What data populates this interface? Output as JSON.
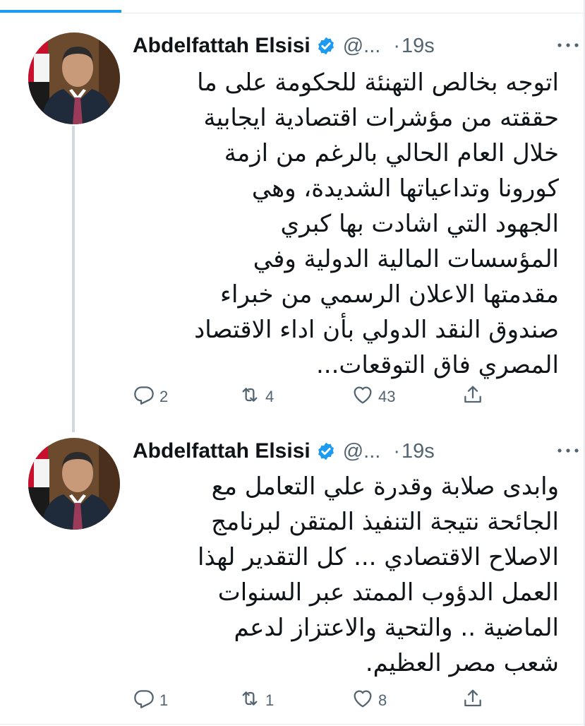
{
  "accent_color": "#1d9bf0",
  "tweets": [
    {
      "author": {
        "name": "Abdelfattah Elsisi",
        "handle": "@...",
        "verified_icon": "verified-badge-icon"
      },
      "separator": "·",
      "time": "19s",
      "text_lines": [
        "اتوجه بخالص التهنئة للحكومة على ما",
        "حققته من مؤشرات اقتصادية ايجابية",
        "خلال العام الحالي بالرغم من ازمة",
        "كورونا وتداعياتها الشديدة، وهي",
        "الجهود التي اشادت بها كبري",
        "المؤسسات المالية الدولية وفي",
        "مقدمتها الاعلان الرسمي من خبراء",
        "صندوق النقد الدولي بأن اداء الاقتصاد",
        "المصري فاق التوقعات..."
      ],
      "actions": {
        "replies": "2",
        "retweets": "4",
        "likes": "43"
      }
    },
    {
      "author": {
        "name": "Abdelfattah Elsisi",
        "handle": "@...",
        "verified_icon": "verified-badge-icon"
      },
      "separator": "·",
      "time": "19s",
      "text_lines": [
        "وابدى صلابة وقدرة علي التعامل مع",
        "الجائحة نتيجة التنفيذ المتقن لبرنامج",
        "الاصلاح الاقتصادي ... كل التقدير لهذا",
        "العمل الدؤوب الممتد عبر السنوات",
        "الماضية .. والتحية والاعتزاز لدعم",
        "شعب مصر العظيم."
      ],
      "actions": {
        "replies": "1",
        "retweets": "1",
        "likes": "8"
      }
    }
  ],
  "icons": {
    "reply": "reply-icon",
    "retweet": "retweet-icon",
    "like": "heart-icon",
    "share": "share-icon",
    "more": "more-options-icon"
  }
}
